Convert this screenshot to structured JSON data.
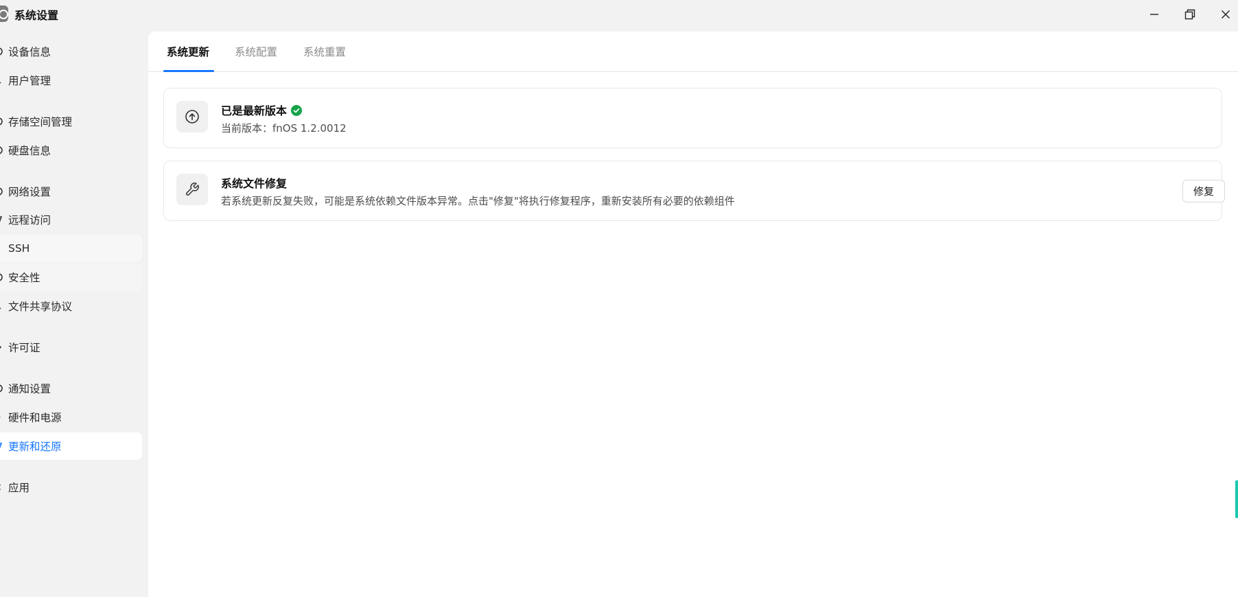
{
  "window": {
    "title": "系统设置",
    "controls": [
      "minimize-icon",
      "maximize-icon",
      "close-icon"
    ]
  },
  "sidebar": {
    "items": [
      {
        "label": "设备信息",
        "icon": "device-icon",
        "state": "normal"
      },
      {
        "label": "用户管理",
        "icon": "user-icon",
        "state": "normal"
      },
      {
        "label": "存储空间管理",
        "icon": "storage-icon",
        "state": "normal"
      },
      {
        "label": "硬盘信息",
        "icon": "disk-icon",
        "state": "normal"
      },
      {
        "label": "网络设置",
        "icon": "network-icon",
        "state": "normal"
      },
      {
        "label": "远程访问",
        "icon": "remote-icon",
        "state": "normal"
      },
      {
        "label": "SSH",
        "icon": "terminal-icon",
        "state": "hover"
      },
      {
        "label": "安全性",
        "icon": "shield-icon",
        "state": "hover-light"
      },
      {
        "label": "文件共享协议",
        "icon": "share-icon",
        "state": "normal"
      },
      {
        "label": "许可证",
        "icon": "license-icon",
        "state": "normal"
      },
      {
        "label": "通知设置",
        "icon": "bell-icon",
        "state": "normal"
      },
      {
        "label": "硬件和电源",
        "icon": "power-icon",
        "state": "normal"
      },
      {
        "label": "更新和还原",
        "icon": "update-icon",
        "state": "active"
      },
      {
        "label": "应用",
        "icon": "apps-icon",
        "state": "normal"
      }
    ]
  },
  "tabs": [
    {
      "label": "系统更新",
      "active": true
    },
    {
      "label": "系统配置",
      "active": false
    },
    {
      "label": "系统重置",
      "active": false
    }
  ],
  "update_card": {
    "title": "已是最新版本",
    "status_icon": "check-circle-icon",
    "description": "当前版本：fnOS 1.2.0012",
    "icon": "upload-arrow-icon"
  },
  "repair_card": {
    "title": "系统文件修复",
    "description": "若系统更新反复失败，可能是系统依赖文件版本异常。点击\"修复\"将执行修复程序，重新安装所有必要的依赖组件",
    "icon": "wrench-icon",
    "button_label": "修复"
  },
  "colors": {
    "accent": "#1677ff",
    "success": "#17a34a",
    "background": "#f2f2f2",
    "panel": "#ffffff"
  }
}
